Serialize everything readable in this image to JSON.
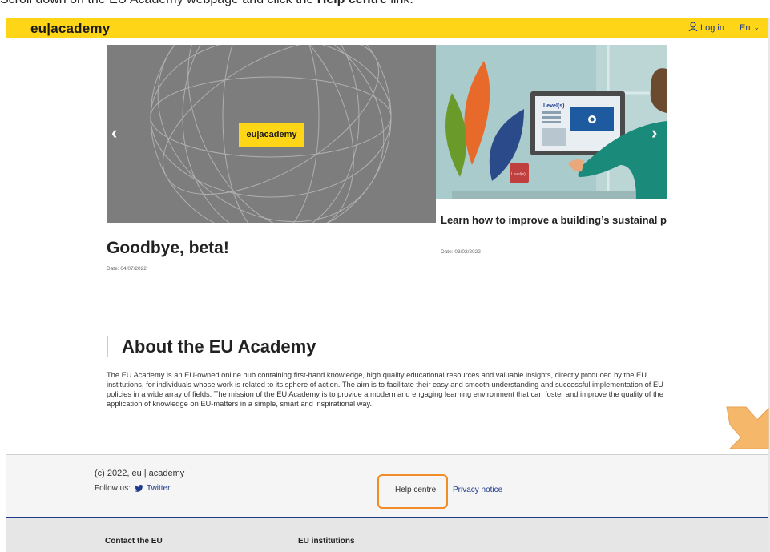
{
  "instruction": {
    "prefix": "Scroll down on the EU Academy webpage and click the ",
    "bold": "Help centre",
    "suffix": " link."
  },
  "header": {
    "brand": "eu|academy",
    "login_label": "Log in",
    "language": "En"
  },
  "carousel": {
    "left": {
      "badge": "eu|academy",
      "title": "Goodbye, beta!",
      "date": "Date: 04/07/2022"
    },
    "right": {
      "title": "Learn how to improve a building’s sustainal performance",
      "date": "Date: 03/02/2022",
      "screen_label": "Level(s)",
      "mug_label": "Level(s)"
    }
  },
  "about": {
    "title": "About the EU Academy",
    "text": "The EU Academy is an EU-owned online hub containing first-hand knowledge, high quality educational resources and valuable insights, directly produced by the EU institutions, for individuals whose work is related to its sphere of action. The aim is to facilitate their easy and smooth understanding and successful implementation of EU policies in a wide array of fields. The mission of the EU Academy is to provide a modern and engaging learning environment that can foster and improve the quality of the application of knowledge on EU-matters in a simple, smart and inspirational way."
  },
  "footer": {
    "copyright": "(c) 2022, eu | academy",
    "follow_label": "Follow us:",
    "twitter": "Twitter",
    "help": "Help centre",
    "privacy": "Privacy notice",
    "contact": "Contact the EU",
    "institutions": "EU institutions"
  },
  "colors": {
    "accent_yellow": "#ffd617",
    "link_blue": "#1e3a8a",
    "highlight_orange": "#f28c28"
  }
}
